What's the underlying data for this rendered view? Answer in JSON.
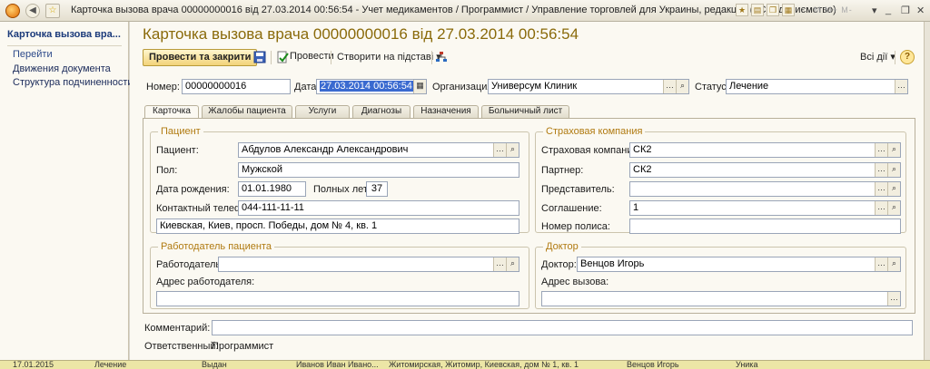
{
  "window": {
    "title": "Карточка вызова врача 00000000016 від 27.03.2014 00:56:54 - Учет медикаментов / Программист / Управление торговлей для Украины, редакці... (1С:Підприємство)",
    "mem": "M M+ M-"
  },
  "sidebar": {
    "title": "Карточка вызова вра...",
    "section": "Перейти",
    "links": [
      "Движения документа",
      "Структура подчиненности"
    ]
  },
  "form": {
    "title": "Карточка вызова врача 00000000016 від 27.03.2014 00:56:54"
  },
  "toolbar": {
    "post_close": "Провести та закрити",
    "post": "Провести",
    "create_based": "Створити на підставі",
    "all_actions": "Всі дії",
    "help": "?"
  },
  "header": {
    "number_label": "Номер:",
    "number": "00000000016",
    "date_label": "Дата:",
    "date": "27.03.2014 00:56:54",
    "org_label": "Организация:",
    "org": "Универсум Клиник",
    "status_label": "Статус:",
    "status": "Лечение"
  },
  "tabs": [
    "Карточка",
    "Жалобы пациента",
    "Услуги",
    "Диагнозы",
    "Назначения",
    "Больничный лист"
  ],
  "patient": {
    "group": "Пациент",
    "patient_label": "Пациент:",
    "patient": "Абдулов Александр Александрович",
    "sex_label": "Пол:",
    "sex": "Мужской",
    "dob_label": "Дата рождения:",
    "dob": "01.01.1980",
    "age_label": "Полных лет:",
    "age": "37",
    "phone_label": "Контактный телефон:",
    "phone": "044-111-11-11",
    "address": "Киевская, Киев, просп. Победы, дом № 4, кв. 1"
  },
  "insurance": {
    "group": "Страховая компания",
    "company_label": "Страховая компания:",
    "company": "СК2",
    "partner_label": "Партнер:",
    "partner": "СК2",
    "rep_label": "Представитель:",
    "rep": "",
    "agreement_label": "Соглашение:",
    "agreement": "1",
    "policy_label": "Номер полиса:",
    "policy": ""
  },
  "employer": {
    "group": "Работодатель пациента",
    "employer_label": "Работодатель:",
    "employer": "",
    "address_label": "Адрес работодателя:",
    "address": ""
  },
  "doctor": {
    "group": "Доктор",
    "doctor_label": "Доктор:",
    "doctor": "Венцов Игорь",
    "call_address_label": "Адрес вызова:",
    "call_address": ""
  },
  "footer": {
    "comment_label": "Комментарий:",
    "comment": "",
    "responsible_label": "Ответственный:",
    "responsible": "Программист"
  },
  "statusbar": {
    "cells": [
      "17.01.2015",
      "Лечение",
      "Выдан",
      "Иванов Иван Ивано...",
      "Житомирская, Житомир, Киевская, дом № 1, кв. 1",
      "Венцов Игорь",
      "Уника"
    ]
  }
}
